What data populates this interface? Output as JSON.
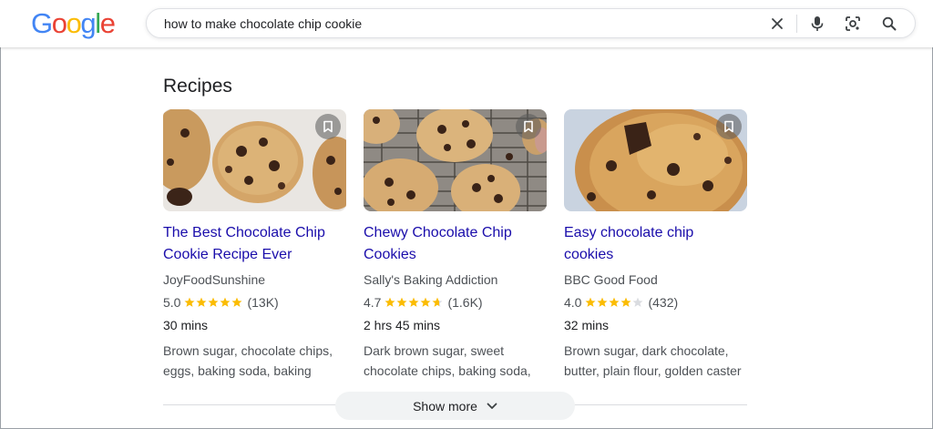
{
  "header": {
    "logo_letters": [
      {
        "ch": "G",
        "color": "#4285F4"
      },
      {
        "ch": "o",
        "color": "#EA4335"
      },
      {
        "ch": "o",
        "color": "#FBBC05"
      },
      {
        "ch": "g",
        "color": "#4285F4"
      },
      {
        "ch": "l",
        "color": "#34A853"
      },
      {
        "ch": "e",
        "color": "#EA4335"
      }
    ],
    "search_query": "how to make chocolate chip cookie",
    "icons": [
      "close-icon",
      "microphone-icon",
      "lens-camera-icon",
      "search-icon"
    ]
  },
  "section_title": "Recipes",
  "recipes": [
    {
      "title_line1": "The Best Chocolate Chip",
      "title_line2": "Cookie Recipe Ever",
      "source": "JoyFoodSunshine",
      "rating": "5.0",
      "rating_value": 5.0,
      "reviews": "(13K)",
      "time": "30 mins",
      "ingredients": "Brown sugar, chocolate chips, eggs, baking soda, baking"
    },
    {
      "title_line1": "Chewy Chocolate Chip",
      "title_line2": "Cookies",
      "source": "Sally's Baking Addiction",
      "rating": "4.7",
      "rating_value": 4.7,
      "reviews": "(1.6K)",
      "time": "2 hrs 45 mins",
      "ingredients": "Dark brown sugar, sweet chocolate chips, baking soda,"
    },
    {
      "title_line1": "Easy chocolate chip",
      "title_line2": "cookies",
      "source": "BBC Good Food",
      "rating": "4.0",
      "rating_value": 4.0,
      "reviews": "(432)",
      "time": "32 mins",
      "ingredients": "Brown sugar, dark chocolate, butter, plain flour, golden caster"
    }
  ],
  "show_more_label": "Show more",
  "colors": {
    "link": "#1a0dab",
    "star_filled": "#fbbc04",
    "star_empty": "#dadce0",
    "secondary_text": "#4d5156"
  }
}
